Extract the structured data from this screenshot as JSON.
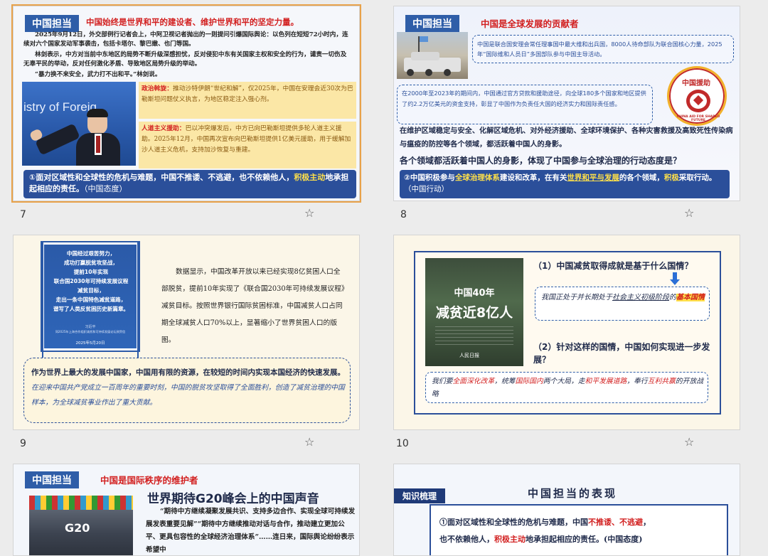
{
  "slides": [
    {
      "num": "7",
      "tag": "中国担当",
      "title": "中国始终是世界和平的建设者、维护世界和平的坚定力量。",
      "p1": "2025年9月12日，外交部例行记者会上，中阿卫视记者抛出的一则提问引爆国际舆论：以色列在短短72小时内，连续对六个国家发动军事袭击，包括卡塔尔、黎巴嫩、也门等国。",
      "p2": "林剑表示，中方对当前中东地区的局势不断升级深感担忧，反对侵犯中东有关国家主权和安全的行为，谴责一切伤及无辜平民的举动，反对任何激化矛盾、导致地区局势升级的举动。",
      "p3": "“暴力换不来安全，武力打不出和平。”林剑说。",
      "photo_text": "istry of Foreig",
      "box1_label": "政治斡旋：",
      "box1": "推动沙特伊朗“世纪和解”，仅2025年，中国在安理会近30次为巴勒斯坦问题仗义执言，为地区稳定注入强心剂。",
      "box2_label": "人道主义援助：",
      "box2": "巴以冲突爆发后，中方已向巴勒斯坦提供多轮人道主义援助。2025年12月，中国再次宣布向巴勒斯坦提供1亿美元援助，用于缓解加沙人道主义危机，支持加沙恢复与重建。",
      "bar_a": "①面对区域性和全球性的危机与难题，中国不推诿、不逃避，也不依赖他人，",
      "bar_hl": "积极主动",
      "bar_b": "地承担起相应的责任。",
      "bar_c": "（中国态度）"
    },
    {
      "num": "8",
      "tag": "中国担当",
      "title": "中国是全球发展的贡献者",
      "d1": "中国是联合国安理会常任理事国中最大维和出兵国，8000人待命部队为联合国核心力量，2025年“国际维和人员日”多国部队参与中国主导活动。",
      "d2": "在2000年至2023年的期间内，中国通过官方贷款和援助途径，向全球180多个国家和地区提供了约2.2万亿美元的资金支持，彰显了中国作为负责任大国的经济实力和国际责任感。",
      "logo_top": "中国援助",
      "logo_ring": "CHINA AID FOR SHARED FUTURE",
      "p1": "在维护区域稳定与安全、化解区域危机、对外经济援助、全球环境保护、各种灾害救援及高致死性传染病与瘟疫的防控等各个领域，都活跃着中国人的身影。",
      "q": "各个领域都活跃着中国人的身影，体现了中国参与全球治理的行动态度是？",
      "bar_a": "②中国积极参与",
      "bar_hl1": "全球治理体系",
      "bar_b": "建设和改革，在有关",
      "bar_u": "世界和平与发展",
      "bar_c": "的各个领域，",
      "bar_hl2": "积极",
      "bar_d": "采取行动。",
      "bar_e": "（中国行动）"
    },
    {
      "num": "9",
      "banner": [
        "中国经过艰苦努力，",
        "成功打赢脱贫攻坚战，",
        "提前10年实现",
        "联合国2030年可持续发展议程",
        "减贫目标，",
        "走出一条中国特色减贫道路，",
        "谱写了人类反贫困历史新篇章。"
      ],
      "banner_sig": "习近平",
      "banner_sig2": "同2025年上海合作组织减贫和可持续发展论坛致贺信",
      "banner_date": "2025年5月20日",
      "p1": "数据显示，中国改革开放以来已经实现8亿贫困人口全部脱贫，提前10年实现了《联合国2030年可持续发展议程》减贫目标。按照世界银行国际贫困标准，中国减贫人口占同期全球减贫人口70%以上，显著缩小了世界贫困人口的版图。",
      "box_a": "作为世界上最大的发展中国家，中国用有限的资源，在较短的时间内实现本国经济的快速发展。",
      "box_b": "在迎来中国共产党成立一百周年的重要时刻，中国的脱贫攻坚取得了全面胜利，创造了减贫治理的中国样本，为全球减贫事业作出了重大贡献。"
    },
    {
      "num": "10",
      "poster_small": "中国40年",
      "poster_big": "减贫近8亿人",
      "poster_logo": "人民日报",
      "q1": "（1）中国减贫取得成就是基于什么国情？",
      "a1_a": "我国正处于并长期处于",
      "a1_u": "社会主义初级阶段",
      "a1_b": "的",
      "a1_hl": "基本国情",
      "q2": "（2）针对这样的国情，中国如何实现进一步发展？",
      "a2_a": "我们要",
      "a2_r1": "全面深化改革",
      "a2_b": "，统筹",
      "a2_r2": "国际国内",
      "a2_c": "两个大局，走",
      "a2_r3": "和平发展道路",
      "a2_d": "，奉行",
      "a2_r4": "互利共赢",
      "a2_e": "的开放战略"
    },
    {
      "tag": "中国担当",
      "title": "中国是国际秩序的维护者",
      "big": "世界期待G20峰会上的中国声音",
      "logo": "G20",
      "p1": "“期待中方继续凝聚发展共识、支持多边合作、实现全球可持续发展发表重要见解”“期待中方继续推动对话与合作，推动建立更加公平、更具包容性的全球经济治理体系”……连日来，国际舆论纷纷表示希望中"
    },
    {
      "label": "知识梳理",
      "title": "中国担当的表现",
      "l1_a": "①面对区域性和全球性的危机与难题，中国",
      "l1_r": "不推诿、不逃避",
      "l1_b": "，",
      "l2_a": "也不依赖他人，",
      "l2_r": "积极主动",
      "l2_b": "地承担起相应的责任。(中国态度)"
    }
  ],
  "colors": {
    "accent": "#2f5ea8",
    "red": "#d21f1f",
    "highlight": "#ffe14a",
    "selection": "#e8a24a"
  }
}
